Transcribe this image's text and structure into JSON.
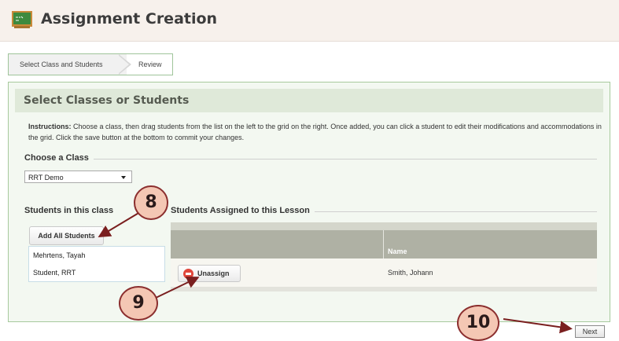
{
  "header": {
    "title": "Assignment Creation",
    "icon": "chalkboard-icon"
  },
  "steps": [
    {
      "label": "Select Class and Students"
    },
    {
      "label": "Review"
    }
  ],
  "panel": {
    "title": "Select Classes or Students",
    "instructions_label": "Instructions:",
    "instructions_text": " Choose a class, then drag students from the list on the left to the grid on the right. Once added, you can click a student to edit their modifications and accommodations in the grid. Click the save button at the bottom to commit your changes."
  },
  "class_section": {
    "legend": "Choose a Class",
    "selected": "RRT Demo"
  },
  "students_section": {
    "legend": "Students in this class",
    "add_all_label": "Add All Students",
    "students": [
      "Mehrtens, Tayah",
      "Student, RRT"
    ]
  },
  "assigned_section": {
    "legend": "Students Assigned to this Lesson",
    "column_name": "Name",
    "rows": [
      {
        "action_label": "Unassign",
        "name": "Smith, Johann"
      }
    ]
  },
  "next_label": "Next",
  "callouts": {
    "c8": "8",
    "c9": "9",
    "c10": "10"
  },
  "colors": {
    "callout_fill": "#f4c7b4",
    "callout_border": "#8b2e2e",
    "panel_bg": "#f3f8f1",
    "grid_header": "#afb1a4"
  }
}
